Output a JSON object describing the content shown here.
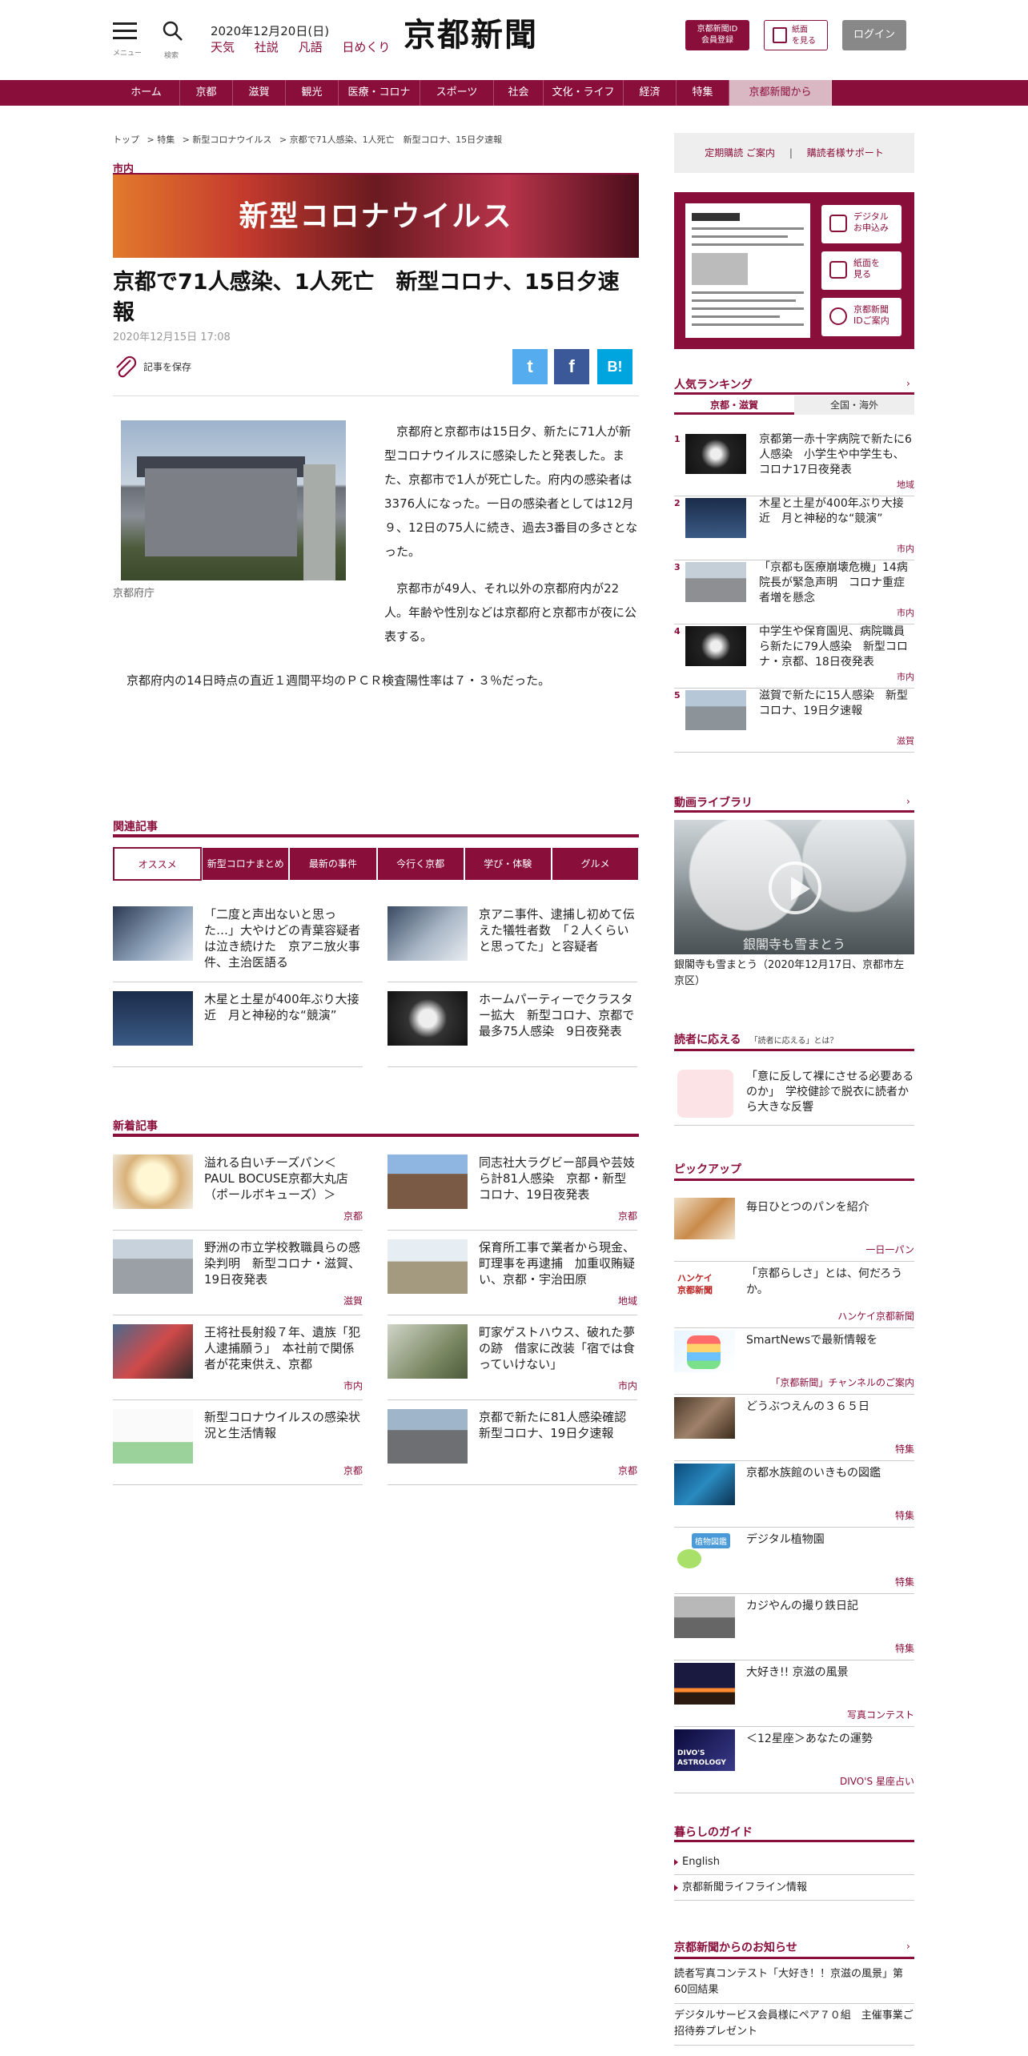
{
  "header": {
    "menu_label": "メニュー",
    "search_label": "検索",
    "date": "2020年12月20日(日)",
    "quicklinks": [
      "天気",
      "社説",
      "凡語",
      "日めくり"
    ],
    "logo": "京都新聞",
    "id_btn": "京都新聞ID\n会員登録",
    "paper_btn": "紙面\nを見る",
    "login_btn": "ログイン"
  },
  "nav": {
    "items": [
      {
        "label": "ホーム",
        "w": 84
      },
      {
        "label": "京都",
        "w": 66
      },
      {
        "label": "滋賀",
        "w": 66
      },
      {
        "label": "観光",
        "w": 66
      },
      {
        "label": "医療・コロナ",
        "w": 102
      },
      {
        "label": "スポーツ",
        "w": 92
      },
      {
        "label": "社会",
        "w": 62
      },
      {
        "label": "文化・ライフ",
        "w": 100
      },
      {
        "label": "経済",
        "w": 66
      },
      {
        "label": "特集",
        "w": 66
      },
      {
        "label": "京都新聞から",
        "w": 128
      }
    ]
  },
  "breadcrumb": [
    "トップ",
    "> 特集",
    "> 新型コロナウイルス",
    "> 京都で71人感染、1人死亡　新型コロナ、15日夕速報"
  ],
  "article": {
    "category": "市内",
    "banner": "新型コロナウイルス",
    "title": "京都で71人感染、1人死亡　新型コロナ、15日夕速報",
    "date": "2020年12月15日 17:08",
    "save_label": "記事を保存",
    "photo_caption": "京都府庁",
    "p1": "京都府と京都市は15日夕、新たに71人が新型コロナウイルスに感染したと発表した。また、京都市で1人が死亡した。府内の感染者は3376人になった。一日の感染者としては12月９、12日の75人に続き、過去3番目の多さとなった。",
    "p2": "京都市が49人、それ以外の京都府内が22人。年齢や性別などは京都府と京都市が夜に公表する。",
    "p3": "京都府内の14日時点の直近１週間平均のＰＣＲ検査陽性率は７・３％だった。"
  },
  "share": {
    "twitter": "t",
    "facebook": "f",
    "hatena": "B!"
  },
  "related": {
    "title": "関連記事",
    "tabs": [
      "オススメ",
      "新型コロナまとめ",
      "最新の事件",
      "今行く京都",
      "学び・体験",
      "グルメ"
    ],
    "items": [
      {
        "title": "「二度と声出ないと思った…」大やけどの青葉容疑者は泣き続けた　京アニ放火事件、主治医語る"
      },
      {
        "title": "京アニ事件、逮捕し初めて伝えた犠牲者数　「２人くらいと思ってた」と容疑者"
      },
      {
        "title": "木星と土星が400年ぶり大接近　月と神秘的な“競演”"
      },
      {
        "title": "ホームパーティーでクラスター拡大　新型コロナ、京都で最多75人感染　9日夜発表"
      }
    ]
  },
  "latest": {
    "title": "新着記事",
    "items": [
      {
        "title": "溢れる白いチーズパン＜PAUL BOCUSE京都大丸店（ポールボキューズ）＞",
        "tag": "京都"
      },
      {
        "title": "同志社大ラグビー部員や芸妓ら計81人感染　京都・新型コロナ、19日夜発表",
        "tag": "京都"
      },
      {
        "title": "野洲の市立学校教職員らの感染判明　新型コロナ・滋賀、19日夜発表",
        "tag": "滋賀"
      },
      {
        "title": "保育所工事で業者から現金、町理事を再逮捕　加重収賄疑い、京都・宇治田原",
        "tag": "地域"
      },
      {
        "title": "王将社長射殺７年、遺族「犯人逮捕願う」　本社前で関係者が花束供え、京都",
        "tag": "市内"
      },
      {
        "title": "町家ゲストハウス、破れた夢の跡　借家に改装「宿では食っていけない」",
        "tag": "市内"
      },
      {
        "title": "新型コロナウイルスの感染状況と生活情報",
        "tag": "京都"
      },
      {
        "title": "京都で新たに81人感染確認　新型コロナ、19日夕速報",
        "tag": "京都"
      }
    ]
  },
  "sidebar": {
    "top_links": [
      "定期購読 ご案内",
      "|",
      "購読者様サポート"
    ],
    "paper_buttons": [
      "デジタル\nお申込み",
      "紙面を\n見る",
      "京都新聞\nIDご案内"
    ],
    "ranking_title": "人気ランキング",
    "ranking_tabs": [
      "京都・滋賀",
      "全国・海外"
    ],
    "ranking": [
      {
        "no": "1",
        "title": "京都第一赤十字病院で新たに6人感染　小学生や中学生も、コロナ17日夜発表",
        "tag": "地域"
      },
      {
        "no": "2",
        "title": "木星と土星が400年ぶり大接近　月と神秘的な“競演”",
        "tag": "市内"
      },
      {
        "no": "3",
        "title": "「京都も医療崩壊危機」14病院長が緊急声明　コロナ重症者増を懸念",
        "tag": "市内"
      },
      {
        "no": "4",
        "title": "中学生や保育園児、病院職員ら新たに79人感染　新型コロナ・京都、18日夜発表",
        "tag": "市内"
      },
      {
        "no": "5",
        "title": "滋賀で新たに15人感染　新型コロナ、19日夕速報",
        "tag": "滋賀"
      }
    ],
    "video_title": "動画ライブラリ",
    "video_overlay": "銀閣寺も雪まとう",
    "video_caption": "銀閣寺も雪まとう（2020年12月17日、京都市左京区）",
    "reader_title": "読者に応える",
    "reader_sub": "「読者に応える」とは？",
    "reader_item": "「意に反して裸にさせる必要あるのか」　学校健診で脱衣に読者から大きな反響",
    "pickup_title": "ピックアップ",
    "pickup": [
      {
        "title": "毎日ひとつのパンを紹介",
        "tag": "一日一パン"
      },
      {
        "title": "「京都らしさ」とは、何だろうか。",
        "tag": "ハンケイ京都新聞"
      },
      {
        "title": "SmartNewsで最新情報を",
        "tag": "「京都新聞」チャンネルのご案内"
      },
      {
        "title": "どうぶつえんの３６５日",
        "tag": "特集"
      },
      {
        "title": "京都水族館のいきもの図鑑",
        "tag": "特集"
      },
      {
        "title": "デジタル植物園",
        "tag": "特集"
      },
      {
        "title": "カジやんの撮り鉄日記",
        "tag": "特集"
      },
      {
        "title": "大好き!! 京滋の風景",
        "tag": "写真コンテスト"
      },
      {
        "title": "＜12星座＞あなたの運勢",
        "tag": "DIVO'S 星座占い"
      }
    ],
    "pickup_badges": {
      "hankei": "ハンケイ\n京都新聞",
      "plant": "植物図鑑",
      "divo": "DIVO'S\nASTROLOGY"
    },
    "guide_title": "暮らしのガイド",
    "guide": [
      "English",
      "京都新聞ライフライン情報"
    ],
    "notice_title": "京都新聞からのお知らせ",
    "notices": [
      "読者写真コンテスト「大好き！！京滋の風景」第60回結果",
      "デジタルサービス会員様にペア７０組　主催事業ご招待券プレゼント"
    ]
  },
  "colors": {
    "brand": "#8a0e3a"
  }
}
